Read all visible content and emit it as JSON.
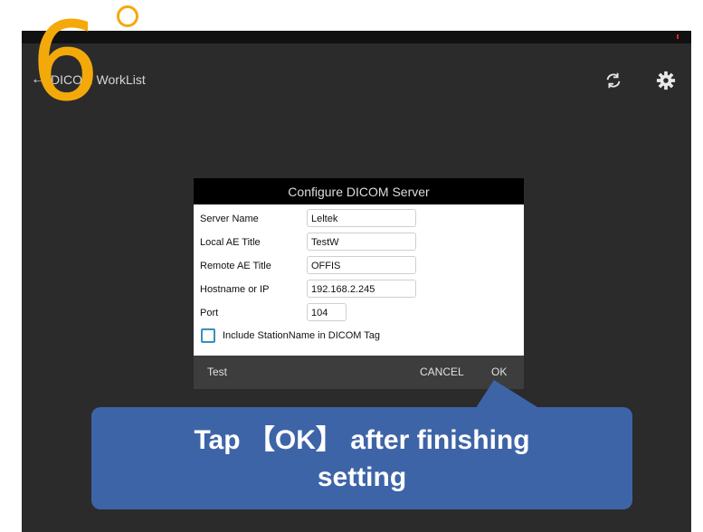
{
  "header": {
    "back_label": "DICOM WorkList",
    "refresh_icon": "refresh-icon",
    "settings_icon": "gear-icon"
  },
  "overlay": {
    "step_number": "6"
  },
  "dialog": {
    "title": "Configure DICOM Server",
    "fields": [
      {
        "label": "Server Name",
        "value": "Leltek"
      },
      {
        "label": "Local AE Title",
        "value": "TestW"
      },
      {
        "label": "Remote AE Title",
        "value": "OFFIS"
      },
      {
        "label": "Hostname or IP",
        "value": "192.168.2.245"
      },
      {
        "label": "Port",
        "value": "104"
      }
    ],
    "checkbox_label": "Include StationName in DICOM Tag",
    "checkbox_checked": false,
    "actions": {
      "test": "Test",
      "cancel": "CANCEL",
      "ok": "OK"
    }
  },
  "callout": {
    "line1": "Tap 【OK】 after finishing",
    "line2": "setting"
  },
  "colors": {
    "accent": "#f4a90b",
    "callout": "#3e64a8",
    "checkbox_border": "#3a8fbf"
  }
}
